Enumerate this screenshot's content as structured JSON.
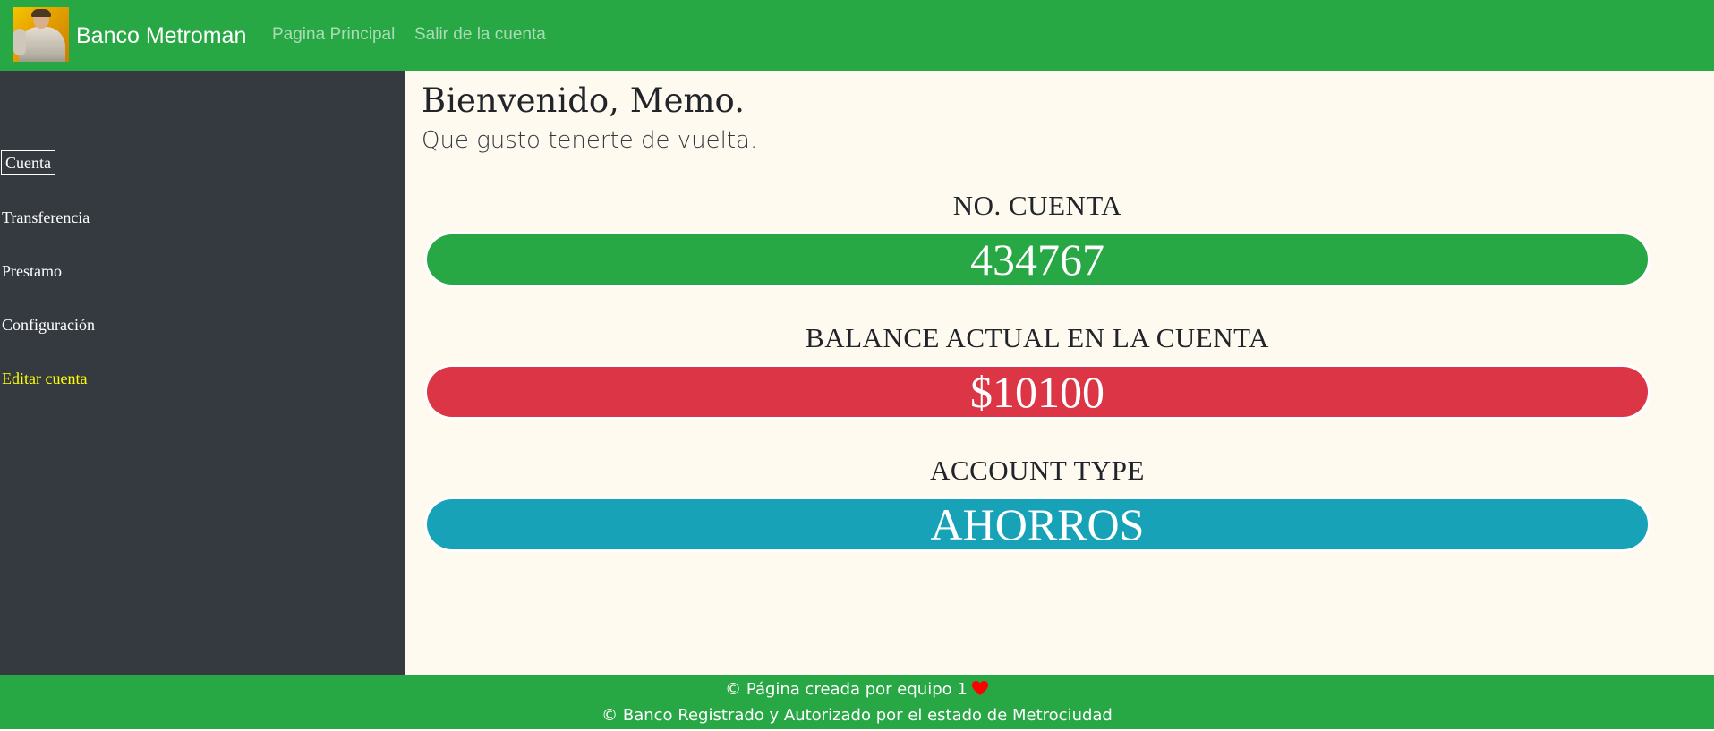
{
  "navbar": {
    "brand": "Banco Metroman",
    "links": [
      {
        "label": "Pagina Principal"
      },
      {
        "label": "Salir de la cuenta"
      }
    ],
    "background": "#28a745"
  },
  "sidebar": {
    "items": [
      {
        "label": "Cuenta",
        "active": true
      },
      {
        "label": "Transferencia"
      },
      {
        "label": "Prestamo"
      },
      {
        "label": "Configuración"
      },
      {
        "label": "Editar cuenta",
        "color": "#ffff00"
      }
    ],
    "background": "#343a40"
  },
  "main": {
    "greeting": "Bienvenido, Memo.",
    "subgreeting": "Que gusto tenerte de vuelta.",
    "sections": [
      {
        "label": "NO. CUENTA",
        "value": "434767",
        "color": "#28a745"
      },
      {
        "label": "BALANCE ACTUAL EN LA CUENTA",
        "value": "$10100",
        "color": "#dc3545"
      },
      {
        "label": "ACCOUNT TYPE",
        "value": "AHORROS",
        "color": "#17a2b8"
      }
    ]
  },
  "footer": {
    "line1": "© Página creada por equipo 1",
    "line2": "© Banco Registrado y Autorizado por el estado de Metrociudad",
    "heart_icon": "heart-icon",
    "heart_color": "#ff0000"
  }
}
